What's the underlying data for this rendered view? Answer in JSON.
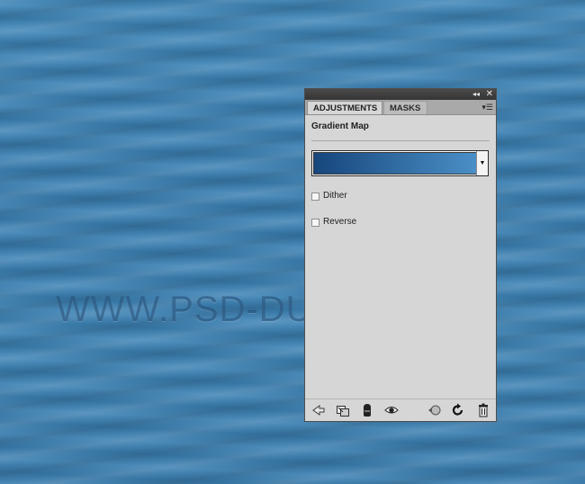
{
  "watermark": "WWW.PSD-DUDE.COM",
  "panel": {
    "tabs": [
      "ADJUSTMENTS",
      "MASKS"
    ],
    "title": "Gradient Map",
    "gradient": {
      "from": "#16467c",
      "to": "#4a8fc6"
    },
    "options": [
      {
        "label": "Dither",
        "checked": false
      },
      {
        "label": "Reverse",
        "checked": false
      }
    ],
    "toolbar_icons": [
      "back-arrow-icon",
      "clip-expand-icon",
      "layer-clip-icon",
      "visibility-eye-icon",
      "previous-state-icon",
      "reset-icon",
      "delete-icon"
    ]
  }
}
